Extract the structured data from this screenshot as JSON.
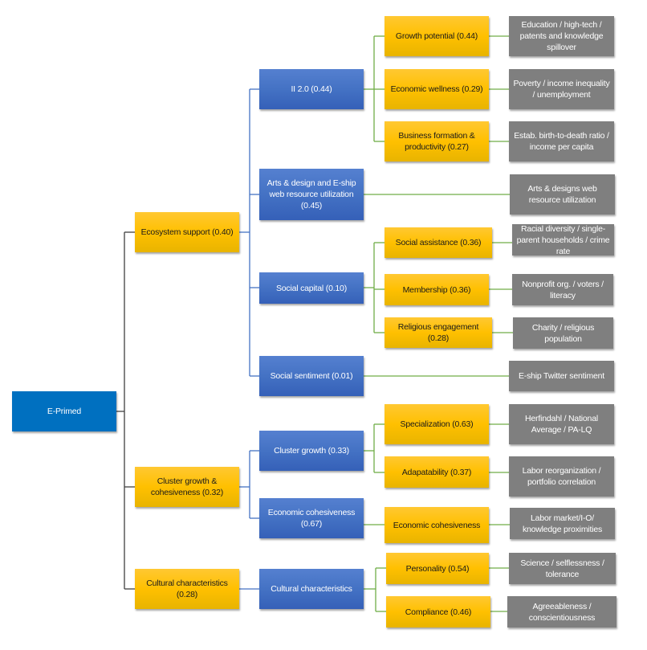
{
  "colors": {
    "root": "#0070C0",
    "level1": "#FFC000",
    "level2": "#4472C4",
    "level3": "#FFC000",
    "indicator": "#7F7F7F",
    "link_dark": "#404040",
    "link_blue": "#4472C4",
    "link_green": "#70AD47"
  },
  "nodes": {
    "root": "E-Primed",
    "ecosystem_support": "Ecosystem support (0.40)",
    "cluster_growth_cohesiveness": "Cluster growth & cohesiveness (0.32)",
    "cultural_characteristics_l1": "Cultural characteristics (0.28)",
    "ii_2_0": "II 2.0 (0.44)",
    "arts_design": "Arts & design and E-ship web resource utilization (0.45)",
    "social_capital": "Social capital (0.10)",
    "social_sentiment": "Social sentiment (0.01)",
    "cluster_growth": "Cluster growth (0.33)",
    "economic_cohesiveness_l2": "Economic cohesiveness (0.67)",
    "cultural_characteristics_l2": "Cultural characteristics",
    "growth_potential": "Growth potential (0.44)",
    "economic_wellness": "Economic wellness (0.29)",
    "business_formation": "Business formation & productivity (0.27)",
    "social_assistance": "Social assistance (0.36)",
    "membership": "Membership (0.36)",
    "religious_engagement": "Religious engagement (0.28)",
    "specialization": "Specialization (0.63)",
    "adaptability": "Adapatability (0.37)",
    "economic_cohesiveness_l3": "Economic cohesiveness",
    "personality": "Personality (0.54)",
    "compliance": "Compliance (0.46)",
    "ind_education": "Education / high-tech / patents and knowledge spillover",
    "ind_poverty": "Poverty / income inequality / unemployment",
    "ind_estab": "Estab. birth-to-death ratio / income per capita",
    "ind_arts": "Arts & designs web resource utilization",
    "ind_racial": "Racial diversity / single-parent households / crime rate",
    "ind_nonprofit": "Nonprofit org. / voters / literacy",
    "ind_charity": "Charity / religious population",
    "ind_twitter": "E-ship Twitter sentiment",
    "ind_herfindahl": "Herfindahl / National Average / PA-LQ",
    "ind_labor_reorg": "Labor reorganization / portfolio correlation",
    "ind_labor_market": "Labor market/I-O/ knowledge proximities",
    "ind_science": "Science / selflessness / tolerance",
    "ind_agreeableness": "Agreeableness / conscientiousness"
  }
}
